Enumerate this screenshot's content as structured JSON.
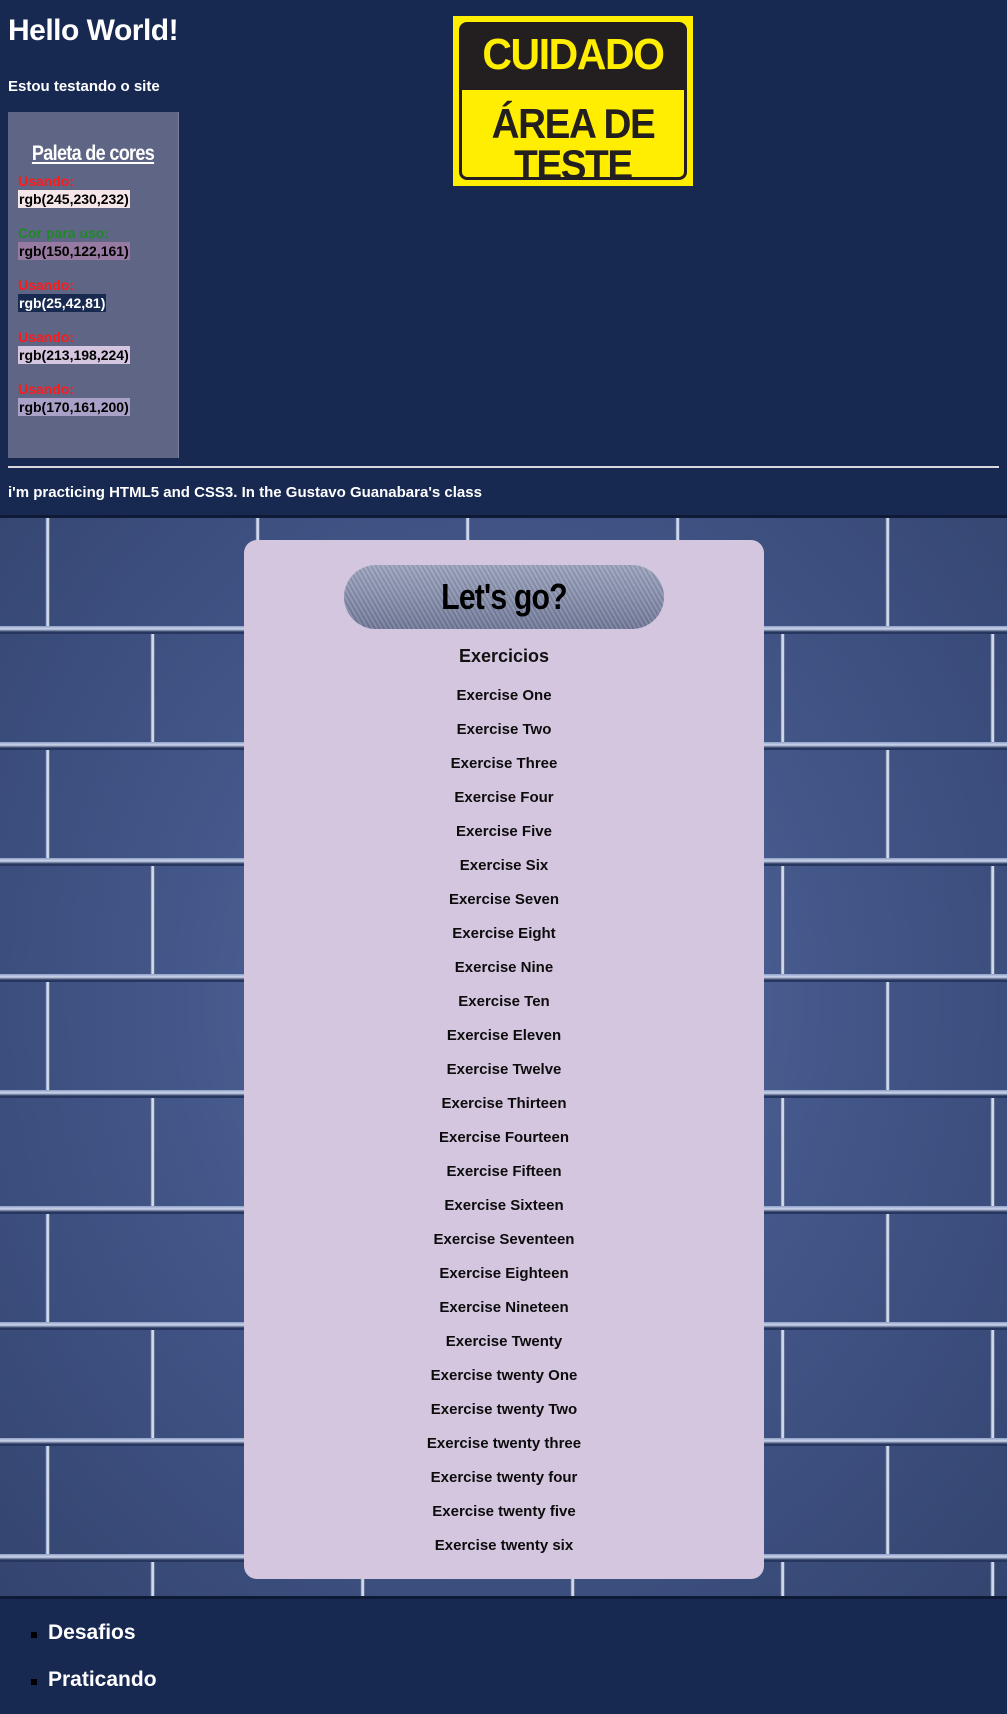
{
  "header": {
    "title": "Hello World!",
    "subtitle": "Estou testando o site",
    "practice_text": "i'm practicing HTML5 and CSS3. In the Gustavo Guanabara's class"
  },
  "palette": {
    "title": "Paleta de cores",
    "items": [
      {
        "label": "Usando:",
        "value": "rgb(245,230,232)",
        "color": "#f5e6e8",
        "label_color": "#ff1a1a",
        "text_color": "#000000"
      },
      {
        "label": "Cor para uso:",
        "value": "rgb(150,122,161)",
        "color": "#967aa1",
        "label_color": "#1e8a24",
        "text_color": "#000000"
      },
      {
        "label": "Usando:",
        "value": "rgb(25,42,81)",
        "color": "#192a51",
        "label_color": "#ff1a1a",
        "text_color": "#ffffff"
      },
      {
        "label": "Usando:",
        "value": "rgb(213,198,224)",
        "color": "#d5c6e0",
        "label_color": "#ff1a1a",
        "text_color": "#000000"
      },
      {
        "label": "Usando:",
        "value": "rgb(170,161,200)",
        "color": "#aaa1c8",
        "label_color": "#ff1a1a",
        "text_color": "#000000"
      }
    ]
  },
  "warning_sign": {
    "line1": "CUIDADO",
    "line2": "ÁREA DE",
    "line3": "TESTE"
  },
  "main": {
    "banner": "Let's go?",
    "heading": "Exercicios",
    "exercises": [
      "Exercise One",
      "Exercise Two",
      "Exercise Three",
      "Exercise Four",
      "Exercise Five",
      "Exercise Six",
      "Exercise Seven",
      "Exercise Eight",
      "Exercise Nine",
      "Exercise Ten",
      "Exercise Eleven",
      "Exercise Twelve",
      "Exercise Thirteen",
      "Exercise Fourteen",
      "Exercise Fifteen",
      "Exercise Sixteen",
      "Exercise Seventeen",
      "Exercise Eighteen",
      "Exercise Nineteen",
      "Exercise Twenty",
      "Exercise twenty One",
      "Exercise twenty Two",
      "Exercise twenty three",
      "Exercise twenty four",
      "Exercise twenty five",
      "Exercise twenty six"
    ]
  },
  "footer": {
    "items": [
      "Desafios",
      "Praticando"
    ]
  },
  "colors": {
    "page_bg": "#172851",
    "card_bg": "#d5c6e0",
    "sign_yellow": "#ffee00",
    "sign_dark": "#231f20"
  }
}
